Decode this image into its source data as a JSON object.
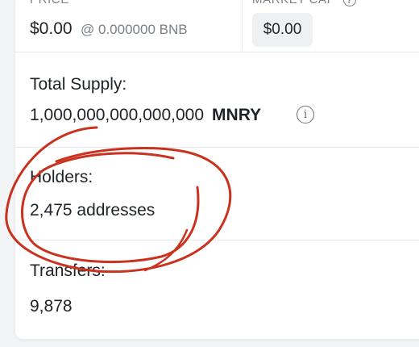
{
  "price": {
    "label": "PRICE",
    "value": "$0.00",
    "sub": "@ 0.000000 BNB"
  },
  "market_cap": {
    "label": "MARKET CAP",
    "value": "$0.00"
  },
  "total_supply": {
    "label": "Total Supply:",
    "amount": "1,000,000,000,000,000",
    "ticker": "MNRY"
  },
  "holders": {
    "label": "Holders:",
    "value": "2,475 addresses"
  },
  "transfers": {
    "label": "Transfers:",
    "value": "9,878"
  },
  "icons": {
    "help": "?",
    "info": "i"
  },
  "colors": {
    "annotation": "#c8321e",
    "text": "#1f2328",
    "muted": "#7b8088",
    "divider": "#e6e8eb"
  }
}
